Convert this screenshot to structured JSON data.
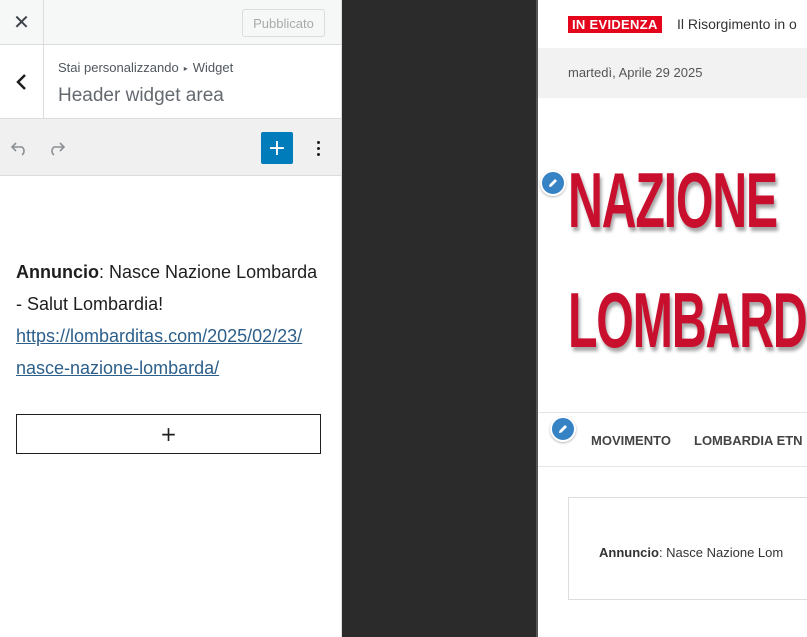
{
  "customizer": {
    "publish_label": "Pubblicato",
    "breadcrumb_prefix": "Stai personalizzando",
    "breadcrumb_section": "Widget",
    "section_title": "Header widget area",
    "widget": {
      "bold_label": "Annuncio",
      "text": ": Nasce Nazione Lombarda - Salut Lombardia!",
      "link": "https://lombarditas.com/2025/02/23/nasce-nazione-lombarda/",
      "link_line1": "https://lombarditas.com/2025/02/23/",
      "link_line2": "nasce-nazione-lombarda/"
    },
    "append_label": "+"
  },
  "preview": {
    "badge": "IN EVIDENZA",
    "ticker": "Il Risorgimento in o",
    "date": "martedì, Aprile 29 2025",
    "brand_line1": "NAZIONE",
    "brand_line2": "LOMBARDA",
    "nav_items": [
      "MOVIMENTO",
      "LOMBARDIA ETN"
    ],
    "announce_bold": "Annuncio",
    "announce_text": ": Nasce Nazione Lom"
  },
  "colors": {
    "accent": "#007cba",
    "brand_red": "#c8102e",
    "badge_red": "#e4051c",
    "edit_blue": "#3582c4"
  }
}
